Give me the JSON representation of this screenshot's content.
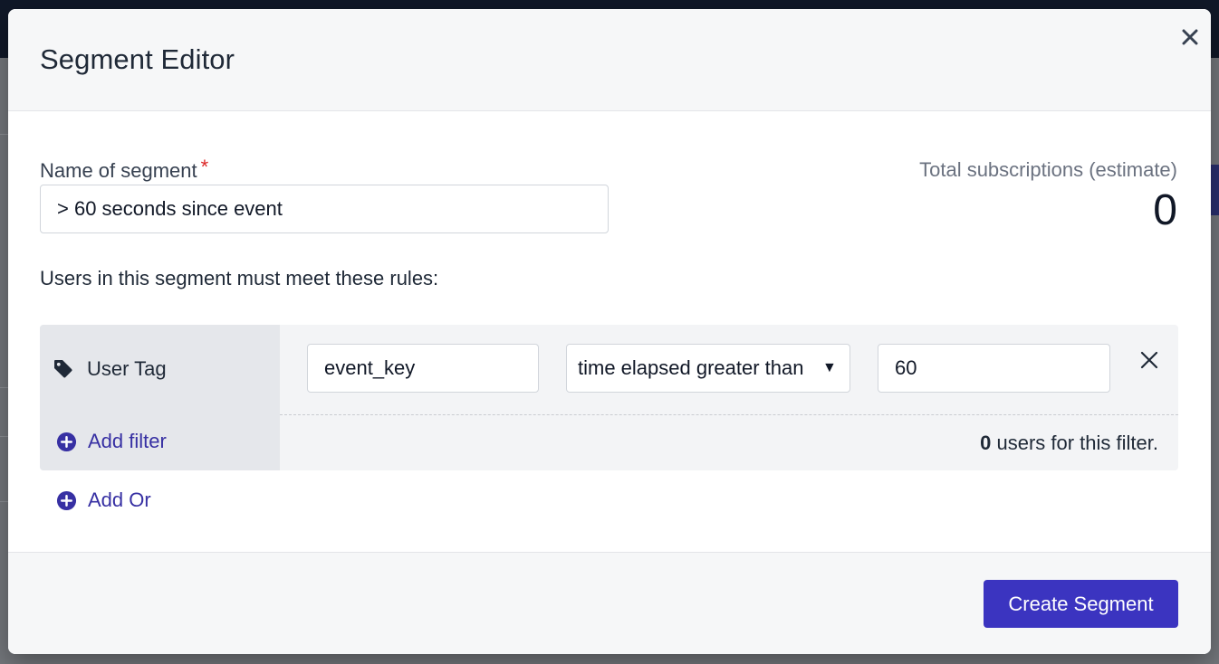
{
  "modal": {
    "title": "Segment Editor"
  },
  "form": {
    "name_label": "Name of segment",
    "required_mark": "*",
    "name_value": "> 60 seconds since event",
    "estimate_label": "Total subscriptions (estimate)",
    "estimate_value": "0",
    "rules_label": "Users in this segment must meet these rules:"
  },
  "rule": {
    "type_label": "User Tag",
    "key_value": "event_key",
    "operator_value": "time elapsed greater than",
    "value": "60",
    "add_filter_label": "Add filter",
    "user_count": "0",
    "user_count_suffix": " users for this filter."
  },
  "add_or_label": "Add Or",
  "footer": {
    "create_label": "Create Segment"
  },
  "colors": {
    "accent": "#3b34c0",
    "link": "#3730a3",
    "required": "#dc2626"
  }
}
